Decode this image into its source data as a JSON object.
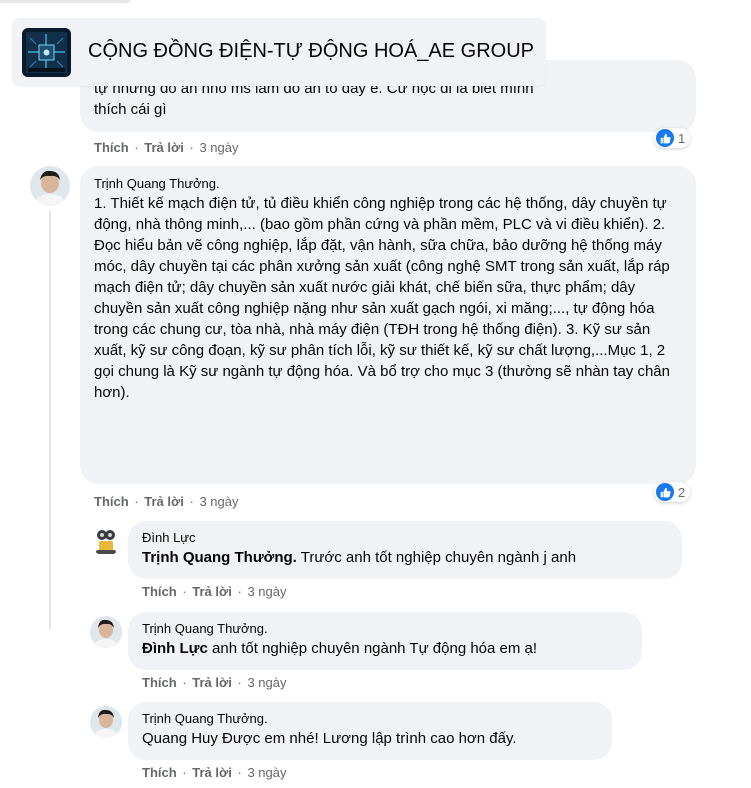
{
  "group": {
    "name": "CỘNG ĐỒNG ĐIỆN-TỰ ĐỘNG HOÁ_AE GROUP"
  },
  "labels": {
    "like": "Thích",
    "reply": "Trả lời",
    "dot": "·"
  },
  "comments": [
    {
      "author": "",
      "text_hidden": "tự nhưng đồ án nhỏ ms làm đồ án to dày e. Cứ học đi là biết mình",
      "text": "thích cái gì",
      "time": "3 ngày",
      "likes": "1"
    },
    {
      "author": "Trịnh Quang Thưởng.",
      "text": "1. Thiết kế mạch điện tử, tủ điều khiển công nghiệp trong các hệ thống, dây chuyền tự động, nhà thông minh,... (bao gồm phần cứng và phần mềm, PLC và vi điều khiển). 2. Đọc hiểu bản vẽ công nghiệp, lắp đặt, vận hành, sữa chữa, bảo dưỡng hệ thống máy móc, dây chuyền tại các phân xưởng sản xuất (công nghệ SMT trong sản xuất, lắp ráp mạch điện tử; dây chuyền sản xuất nước giải khát, chế biến sữa, thực phẩm; dây chuyền sản xuất công nghiệp nặng như sản xuất gạch ngói, xi măng;..., tự động hóa trong các chung cư, tòa nhà, nhà máy điện (TĐH trong hệ thống điện). 3. Kỹ sư sản xuất, kỹ sư công đoạn, kỹ sư phân tích lỗi, kỹ sư thiết kế, kỹ sư chất lượng,...Mục 1, 2 gọi chung là Kỹ sư ngành tự động hóa. Và bổ trợ cho mục 3 (thường sẽ nhàn tay chân hơn).",
      "time": "3 ngày",
      "likes": "2"
    }
  ],
  "replies": [
    {
      "author": "Đình Lực",
      "mention": "Trịnh Quang Thưởng.",
      "text": " Trước anh tốt nghiệp chuyên ngành j anh",
      "time": "3 ngày"
    },
    {
      "author": "Trịnh Quang Thưởng.",
      "mention": "Đình Lực",
      "text": " anh tốt nghiệp chuyên ngành Tự động hóa em ạ!",
      "time": "3 ngày"
    },
    {
      "author": "Trịnh Quang Thưởng.",
      "mention": "",
      "text": "Quang Huy Được em nhé! Lương lập trình cao hơn đấy.",
      "time": "3 ngày"
    }
  ],
  "colors": {
    "bubble": "#f0f2f5",
    "like_blue": "#1877f2",
    "meta_gray": "#65676b"
  }
}
